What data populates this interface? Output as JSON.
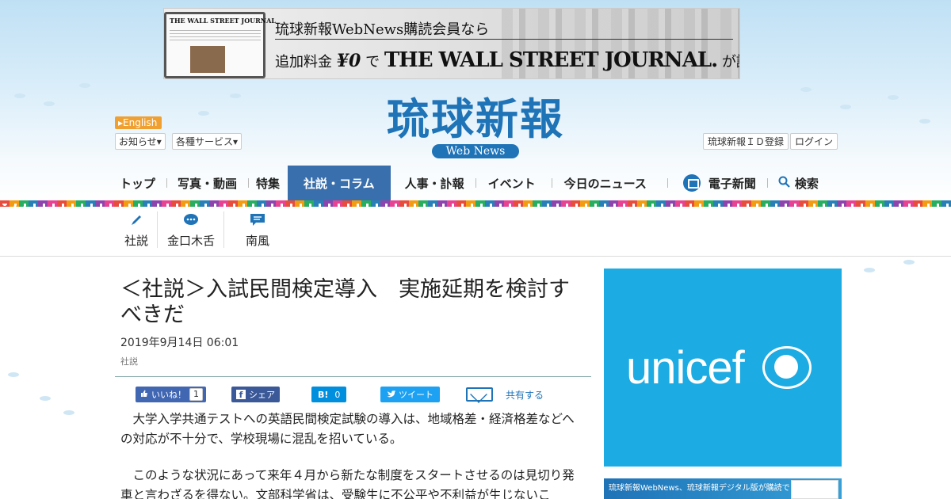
{
  "ad_banner": {
    "line1": "琉球新報WebNews購読会員なら",
    "line2_prefix": "追加料金",
    "line2_price": "¥0",
    "line2_mid": "で",
    "line2_brand": "THE WALL STREET JOURNAL.",
    "line2_suffix": "が読める",
    "laptop_masthead": "THE WALL STREET JOURNAL"
  },
  "header": {
    "logo_main": "琉球新報",
    "logo_sub": "Web News",
    "lang_button": "English",
    "notices": "お知らせ",
    "services": "各種サービス",
    "register": "琉球新報ＩＤ登録",
    "login": "ログイン"
  },
  "nav": {
    "items": [
      "トップ",
      "写真・動画",
      "特集",
      "社説・コラム",
      "人事・訃報",
      "イベント",
      "今日のニュース",
      "電子新聞",
      "検索"
    ],
    "active_index": 3
  },
  "subnav": {
    "items": [
      "社説",
      "金口木舌",
      "南風"
    ]
  },
  "article": {
    "title": "＜社説＞入試民間検定導入　実施延期を検討すべきだ",
    "date": "2019年9月14日 06:01",
    "category": "社説",
    "share": {
      "like_label": "いいね！",
      "like_count": "1",
      "fb_share": "シェア",
      "hatena_label": "B!",
      "hatena_count": "0",
      "tweet": "ツイート",
      "mail_share": "共有する"
    },
    "paragraphs": [
      "大学入学共通テストへの英語民間検定試験の導入は、地域格差・経済格差などへの対応が不十分で、学校現場に混乱を招いている。",
      "このような状況にあって来年４月から新たな制度をスタートさせるのは見切り発車と言わざるを得ない。文部科学省は、受験生に不公平や不利益が生じないこ"
    ]
  },
  "sidebar": {
    "ad1_word": "unicef",
    "ad2_text": "琉球新報WebNews、琉球新報デジタル版が購読できる"
  },
  "colors": {
    "brand": "#1f73b7",
    "nav_active": "#3a6fae",
    "unicef": "#1cabe2",
    "lang_button": "#f0a030"
  }
}
